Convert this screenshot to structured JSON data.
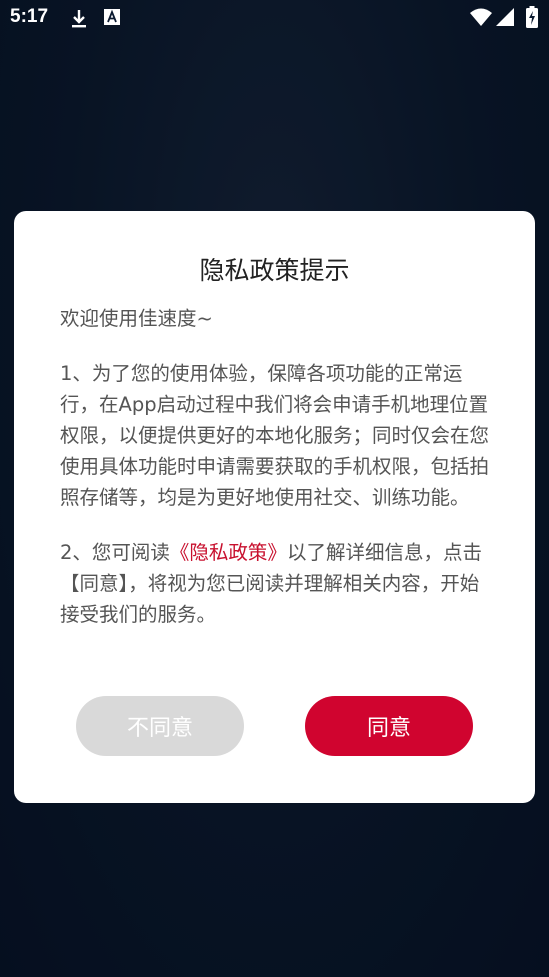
{
  "status_bar": {
    "time": "5:17",
    "icons": [
      "download-icon",
      "a11y-font-icon",
      "wifi-icon",
      "signal-icon",
      "battery-charging-icon"
    ]
  },
  "dialog": {
    "title": "隐私政策提示",
    "greeting": "欢迎使用佳速度~",
    "paragraph1": "1、为了您的使用体验，保障各项功能的正常运行，在App启动过程中我们将会申请手机地理位置权限，以便提供更好的本地化服务；同时仅会在您使用具体功能时申请需要获取的手机权限，包括拍照存储等，均是为更好地使用社交、训练功能。",
    "paragraph2_prefix": "2、您可阅读",
    "paragraph2_link": "《隐私政策》",
    "paragraph2_suffix": "以了解详细信息，点击【同意】，将视为您已阅读并理解相关内容，开始接受我们的服务。",
    "disagree_label": "不同意",
    "agree_label": "同意"
  },
  "colors": {
    "accent": "#d0042f",
    "link": "#c8102e",
    "disabled": "#d9d9d9",
    "background": "#0b1a30"
  }
}
